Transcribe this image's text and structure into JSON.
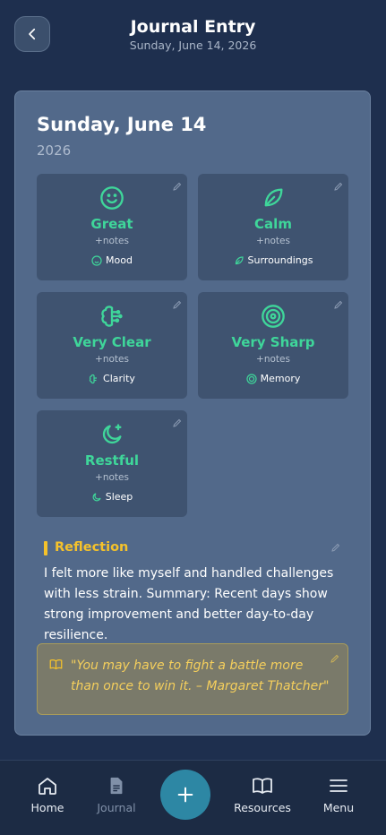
{
  "header": {
    "title": "Journal Entry",
    "subtitle": "Sunday, June 14, 2026"
  },
  "entry": {
    "title": "Sunday, June 14",
    "year": "2026"
  },
  "tiles": [
    {
      "value": "Great",
      "notes": "+notes",
      "label": "Mood",
      "icon": "smile-icon"
    },
    {
      "value": "Calm",
      "notes": "+notes",
      "label": "Surroundings",
      "icon": "leaf-icon"
    },
    {
      "value": "Very Clear",
      "notes": "+notes",
      "label": "Clarity",
      "icon": "brain-icon"
    },
    {
      "value": "Very Sharp",
      "notes": "+notes",
      "label": "Memory",
      "icon": "target-icon"
    },
    {
      "value": "Restful",
      "notes": "+notes",
      "label": "Sleep",
      "icon": "moon-icon"
    }
  ],
  "reflection": {
    "title": "Reflection",
    "text": "I felt more like myself and handled challenges with less strain. Summary: Recent days show strong improvement and better day-to-day resilience.",
    "quote": "\"You may have to fight a battle more than once to win it. – Margaret Thatcher\""
  },
  "nav": {
    "home": "Home",
    "journal": "Journal",
    "resources": "Resources",
    "menu": "Menu"
  },
  "colors": {
    "accent_green": "#3fd69a",
    "accent_yellow": "#f5c22b",
    "fab": "#2d87a4",
    "background": "#1e2f4e",
    "card": "#52698a"
  }
}
